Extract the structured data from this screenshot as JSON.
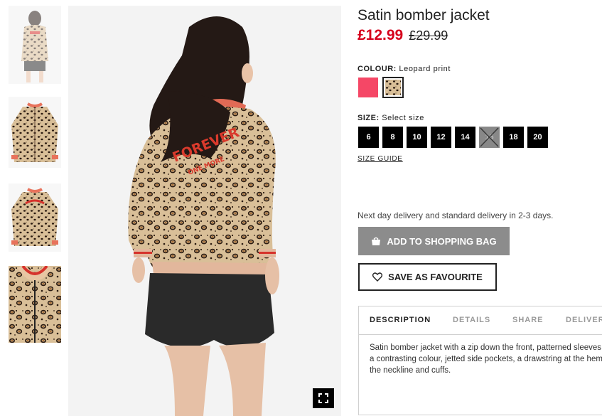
{
  "product": {
    "title": "Satin bomber jacket",
    "price_sale": "£12.99",
    "price_old": "£29.99"
  },
  "colour": {
    "label": "COLOUR:",
    "selected": "Leopard print",
    "swatches": [
      {
        "name": "Pink",
        "color": "#f54766"
      },
      {
        "name": "Leopard print",
        "pattern": "leopard"
      }
    ]
  },
  "size": {
    "label": "SIZE:",
    "selected": "Select size",
    "options": [
      "6",
      "8",
      "10",
      "12",
      "14",
      "16",
      "18",
      "20"
    ],
    "unavailable": [
      "16"
    ],
    "guide_label": "SIZE GUIDE"
  },
  "delivery": {
    "text": "Next day delivery and standard delivery in 2-3 days."
  },
  "buttons": {
    "add_to_bag": "ADD TO SHOPPING BAG",
    "save_favourite": "SAVE AS FAVOURITE"
  },
  "tabs": {
    "items": [
      "DESCRIPTION",
      "DETAILS",
      "SHARE",
      "DELIVERY"
    ],
    "active": "DESCRIPTION"
  },
  "description": {
    "lines": [
      "Satin bomber jacket with a zip down the front, patterned sleeves in",
      "a contrasting colour, jetted side pockets, a drawstring at the hem and",
      "the neckline and cuffs."
    ]
  },
  "image_text": {
    "jacket_print_line1": "FOREVER",
    "jacket_print_line2": "ONE MORE"
  },
  "icons": {
    "bag": "shopping-bag-icon",
    "heart": "heart-icon",
    "fullscreen": "fullscreen-icon"
  },
  "colors": {
    "sale_price": "#d6001c",
    "button_disabled": "#8c8c8c",
    "size_box": "#000000",
    "pink_swatch": "#f54766"
  }
}
